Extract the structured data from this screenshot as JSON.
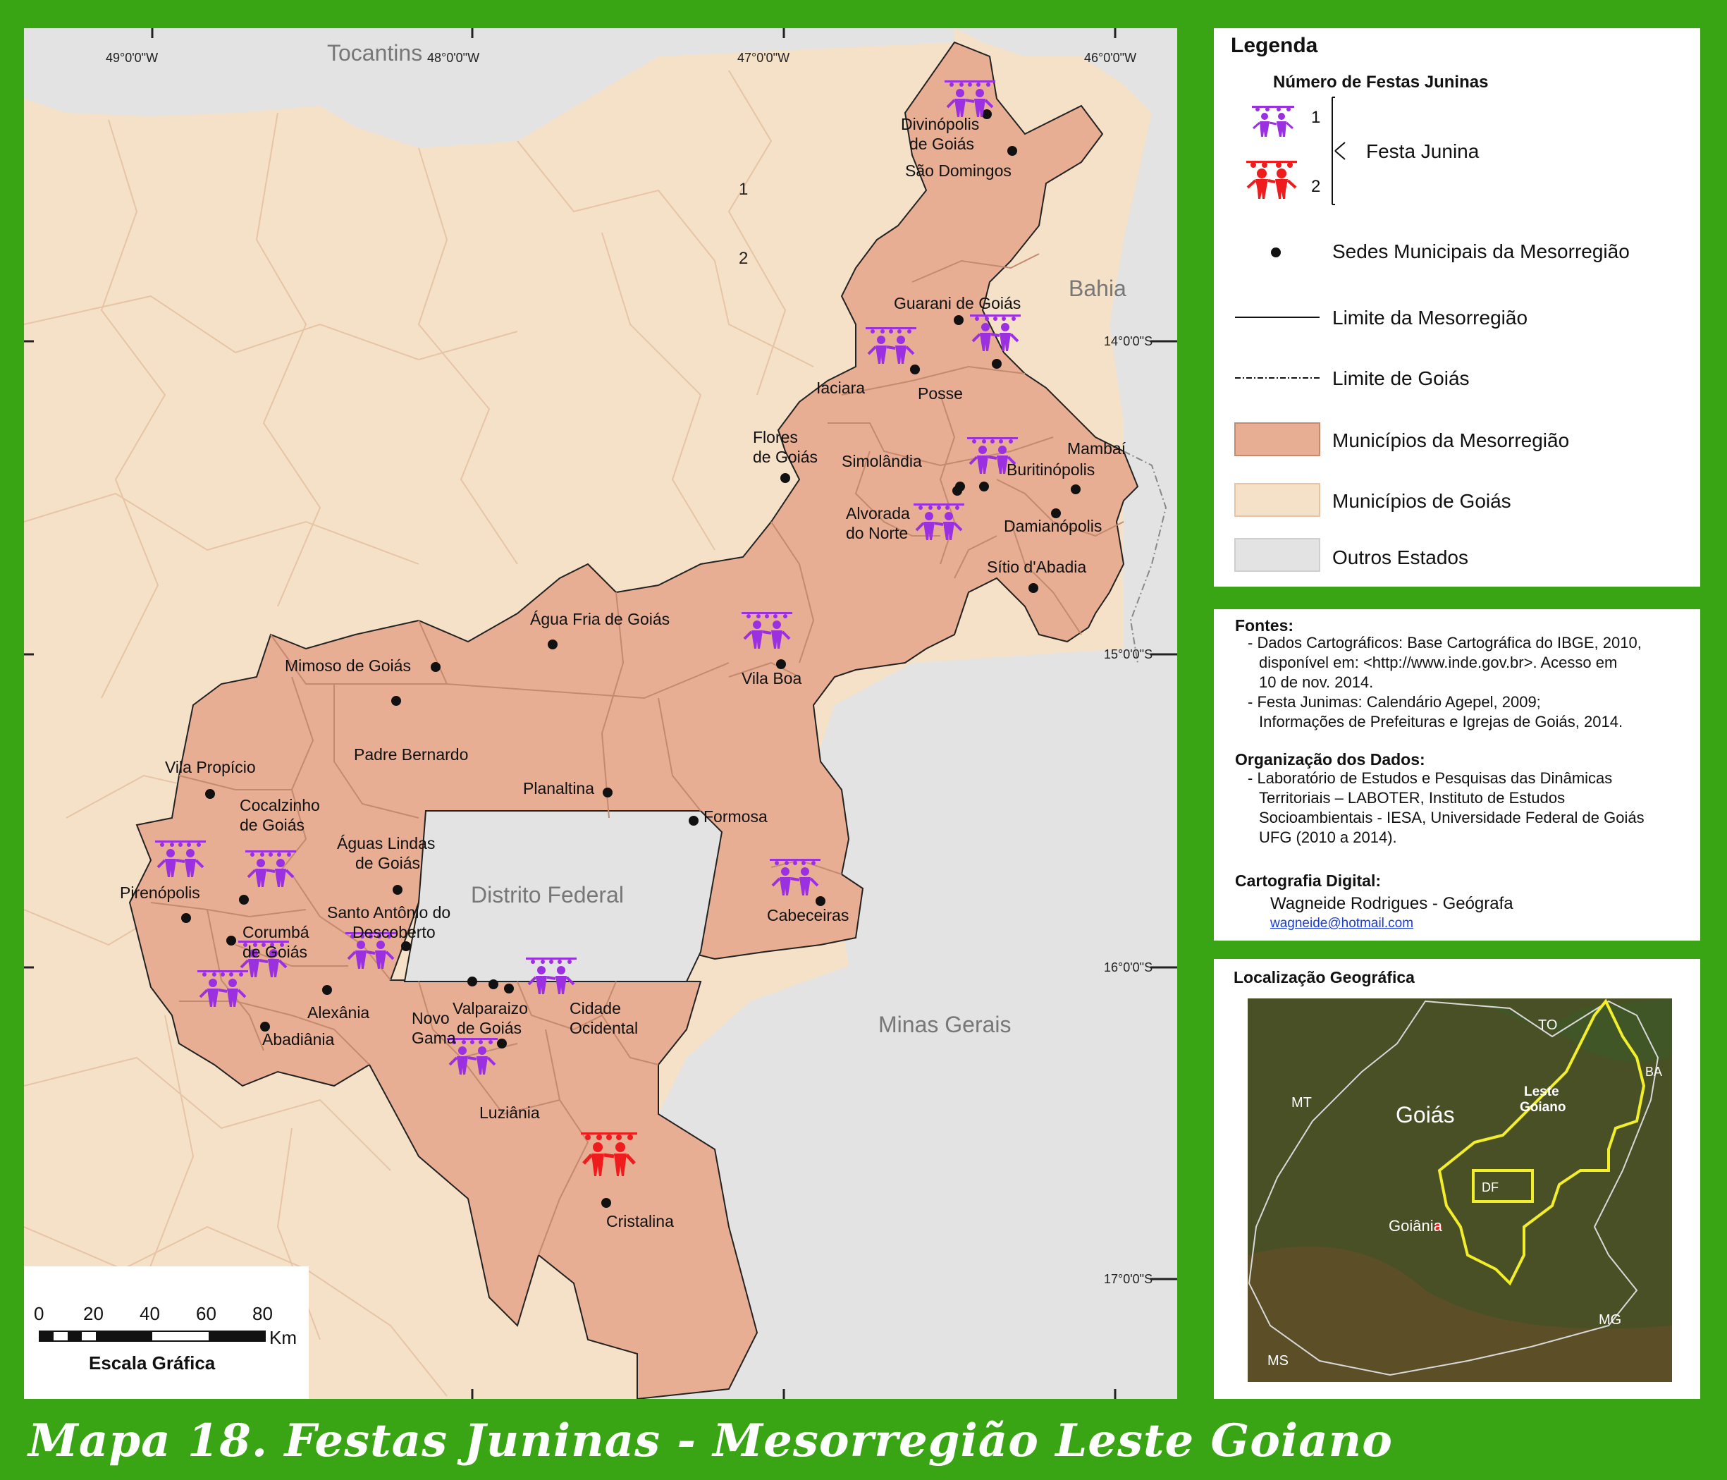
{
  "caption": "Mapa 18. Festas Juninas - Mesorregião Leste Goiano",
  "map": {
    "lon_labels": [
      "49°0'0\"W",
      "48°0'0\"W",
      "47°0'0\"W",
      "46°0'0\"W"
    ],
    "lat_labels": [
      "14°0'0\"S",
      "15°0'0\"S",
      "16°0'0\"S",
      "17°0'0\"S"
    ],
    "states": {
      "tocantins": "Tocantins",
      "bahia": "Bahia",
      "df": "Distrito Federal",
      "mg": "Minas Gerais"
    },
    "inset_numbers": [
      "1",
      "2"
    ],
    "municipalities": [
      {
        "name": "Divinópolis",
        "line2": "de Goiás"
      },
      {
        "name": "São Domingos"
      },
      {
        "name": "Guarani de Goiás"
      },
      {
        "name": "Iaciara"
      },
      {
        "name": "Posse"
      },
      {
        "name": "Flores",
        "line2": "de Goiás"
      },
      {
        "name": "Simolândia"
      },
      {
        "name": "Mambaí"
      },
      {
        "name": "Buritinópolis"
      },
      {
        "name": "Alvorada",
        "line2": "do Norte"
      },
      {
        "name": "Damianópolis"
      },
      {
        "name": "Sítio d'Abadia"
      },
      {
        "name": "Água Fria de Goiás"
      },
      {
        "name": "Vila Boa"
      },
      {
        "name": "Mimoso de Goiás"
      },
      {
        "name": "Padre Bernardo"
      },
      {
        "name": "Planaltina"
      },
      {
        "name": "Formosa"
      },
      {
        "name": "Vila Propício"
      },
      {
        "name": "Cocalzinho",
        "line2": "de Goiás"
      },
      {
        "name": "Águas Lindas",
        "line2": "de Goiás"
      },
      {
        "name": "Pirenópolis"
      },
      {
        "name": "Santo Antônio do",
        "line2": "Descoberto"
      },
      {
        "name": "Corumbá",
        "line2": "de Goiás"
      },
      {
        "name": "Cabeceiras"
      },
      {
        "name": "Alexânia"
      },
      {
        "name": "Abadiânia"
      },
      {
        "name": "Novo",
        "line2": "Gama"
      },
      {
        "name": "Valparaizo",
        "line2": "de Goiás"
      },
      {
        "name": "Cidade",
        "line2": "Ocidental"
      },
      {
        "name": "Luziânia"
      },
      {
        "name": "Cristalina"
      }
    ],
    "festas": [
      {
        "municipality": "Divinópolis de Goiás",
        "count": 1
      },
      {
        "municipality": "Guarani de Goiás",
        "count": 1
      },
      {
        "municipality": "Iaciara",
        "count": 1
      },
      {
        "municipality": "Buritinópolis",
        "count": 1
      },
      {
        "municipality": "Alvorada do Norte",
        "count": 1
      },
      {
        "municipality": "Vila Boa",
        "count": 1
      },
      {
        "municipality": "Pirenópolis",
        "count": 1
      },
      {
        "municipality": "Cocalzinho de Goiás",
        "count": 1
      },
      {
        "municipality": "Corumbá de Goiás",
        "count": 1
      },
      {
        "municipality": "Abadiânia",
        "count": 1
      },
      {
        "municipality": "Alexânia",
        "count": 1
      },
      {
        "municipality": "Cidade Ocidental",
        "count": 1
      },
      {
        "municipality": "Luziânia",
        "count": 1
      },
      {
        "municipality": "Cabeceiras",
        "count": 1
      },
      {
        "municipality": "Cristalina",
        "count": 2
      }
    ],
    "scale": {
      "ticks": [
        "0",
        "20",
        "40",
        "60",
        "80"
      ],
      "unit": "Km",
      "title": "Escala Gráfica"
    }
  },
  "legend": {
    "title": "Legenda",
    "subtitle": "Número de Festas Juninas",
    "count_1": "1",
    "count_2": "2",
    "festa_label": "Festa Junina",
    "items": [
      "Sedes Municipais da Mesorregião",
      "Limite da Mesorregião",
      "Limite de Goiás",
      "Municípios da Mesorregião",
      "Municípios de Goiás",
      "Outros Estados"
    ],
    "colors": {
      "one": "#9b30e0",
      "two": "#ee1c1c",
      "meso": "#e8ae93",
      "goias": "#f5e1c8",
      "others": "#e3e3e3"
    }
  },
  "sources": {
    "fontes_title": "Fontes:",
    "fontes_1a": "- Dados Cartográficos: Base Cartográfica do IBGE, 2010,",
    "fontes_1b": "disponível em: <http://www.inde.gov.br>.  Acesso em",
    "fontes_1c": "10 de nov. 2014.",
    "fontes_2a": "- Festa Junimas: Calendário Agepel, 2009;",
    "fontes_2b": "Informações de Prefeituras e Igrejas de Goiás, 2014.",
    "org_title": "Organização dos Dados:",
    "org_1": "- Laboratório de Estudos e Pesquisas das  Dinâmicas",
    "org_2": "Territoriais – LABOTER, Instituto de Estudos",
    "org_3": "Socioambientais - IESA, Universidade Federal de Goiás",
    "org_4": "UFG (2010 a 2014).",
    "carto_title": "Cartografia Digital:",
    "carto_name": "Wagneide Rodrigues - Geógrafa",
    "carto_email": "wagneide@hotmail.com"
  },
  "location": {
    "title": "Localização Geográfica",
    "labels": {
      "to": "TO",
      "ba": "BA",
      "mt": "MT",
      "goias": "Goiás",
      "leste_1": "Leste",
      "leste_2": "Goiano",
      "df": "DF",
      "goiania": "Goiânia",
      "mg": "MG",
      "ms": "MS"
    }
  }
}
